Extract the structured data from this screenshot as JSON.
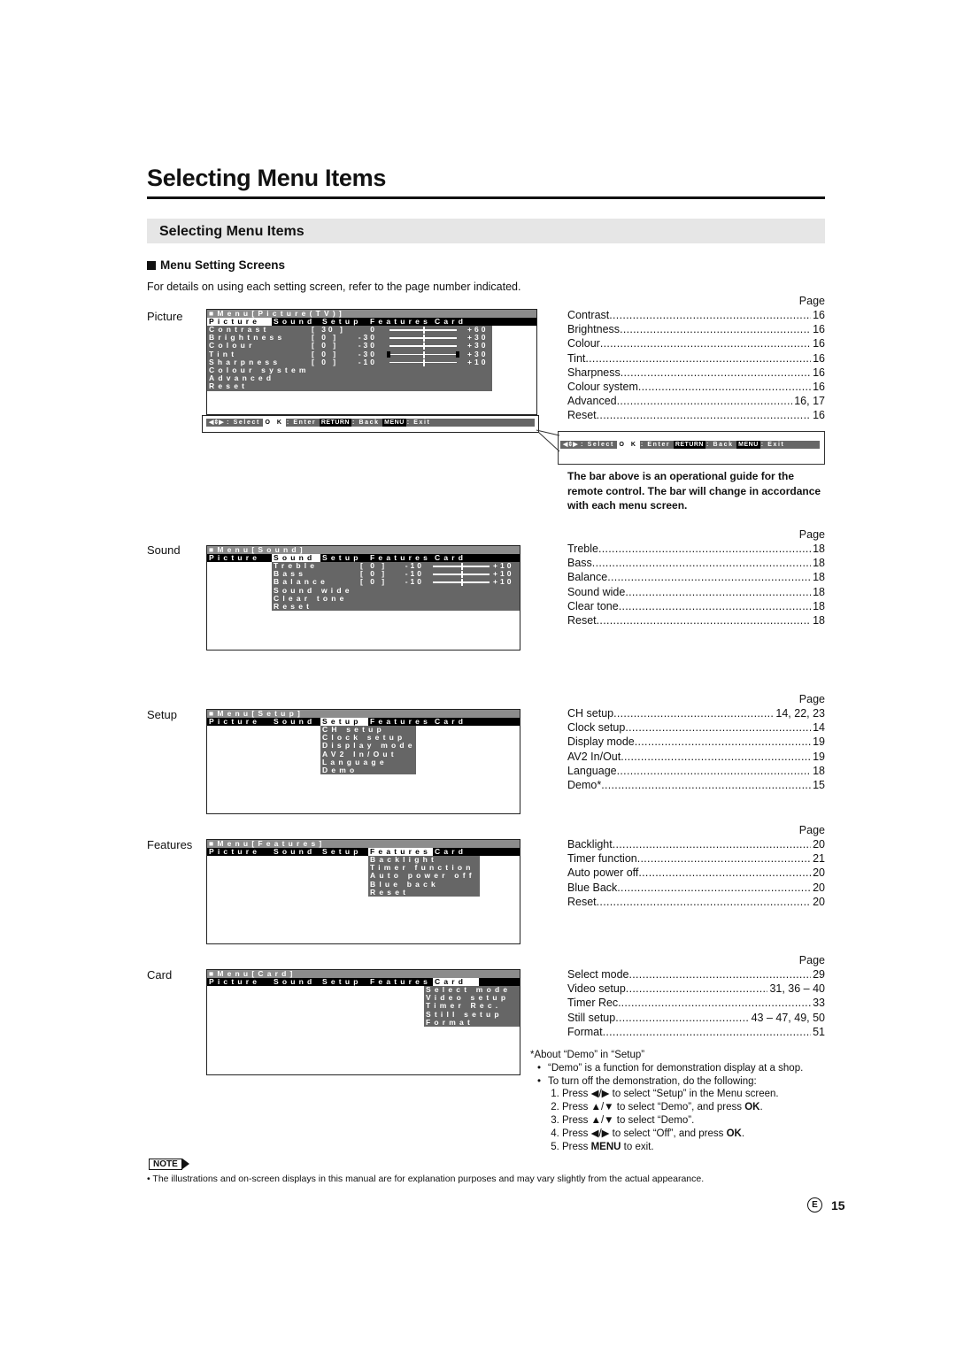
{
  "page": {
    "title": "Selecting Menu Items",
    "section_title": "Selecting Menu Items",
    "subsection_title": "Menu Setting Screens",
    "intro": "For details on using each setting screen, refer to the page number indicated.",
    "page_header": "Page"
  },
  "screens": {
    "picture": {
      "label": "Picture",
      "osd_title": "■Menu[Picture(TV)]",
      "tabs": [
        "Picture",
        "Sound",
        "Setup",
        "Features",
        "Card"
      ],
      "active_tab": "Picture",
      "rows": [
        {
          "name": "Contrast",
          "value": "30",
          "min": "0",
          "max": "+60"
        },
        {
          "name": "Brightness",
          "value": "0",
          "min": "-30",
          "max": "+30"
        },
        {
          "name": "Colour",
          "value": "0",
          "min": "-30",
          "max": "+30"
        },
        {
          "name": "Tint",
          "value": "0",
          "min": "-30",
          "max": "+30"
        },
        {
          "name": "Sharpness",
          "value": "0",
          "min": "-10",
          "max": "+10"
        },
        {
          "name": "Colour system"
        },
        {
          "name": "Advanced"
        },
        {
          "name": "Reset"
        }
      ],
      "guide": {
        "select": ": Select",
        "ok": "O K",
        "enter": ": Enter",
        "return": "RETURN",
        "back": ": Back",
        "menu": "MENU",
        "exit": ": Exit"
      },
      "pages": [
        {
          "item": "Contrast",
          "page": "16"
        },
        {
          "item": "Brightness",
          "page": "16"
        },
        {
          "item": "Colour",
          "page": "16"
        },
        {
          "item": "Tint",
          "page": "16"
        },
        {
          "item": "Sharpness",
          "page": "16"
        },
        {
          "item": "Colour system",
          "page": "16"
        },
        {
          "item": "Advanced",
          "page": "16, 17"
        },
        {
          "item": "Reset",
          "page": "16"
        }
      ]
    },
    "guide_note": "The bar above is an operational guide for the remote control. The bar will change in accordance with each menu screen.",
    "sound": {
      "label": "Sound",
      "osd_title": "■Menu[Sound]",
      "active_tab": "Sound",
      "rows": [
        {
          "name": "Treble",
          "value": "0",
          "min": "-10",
          "max": "+10"
        },
        {
          "name": "Bass",
          "value": "0",
          "min": "-10",
          "max": "+10"
        },
        {
          "name": "Balance",
          "value": "0",
          "min": "-10",
          "max": "+10"
        },
        {
          "name": "Sound wide"
        },
        {
          "name": "Clear tone"
        },
        {
          "name": "Reset"
        }
      ],
      "pages": [
        {
          "item": "Treble",
          "page": "18"
        },
        {
          "item": "Bass",
          "page": "18"
        },
        {
          "item": "Balance",
          "page": "18"
        },
        {
          "item": "Sound wide",
          "page": "18"
        },
        {
          "item": "Clear tone",
          "page": "18"
        },
        {
          "item": "Reset",
          "page": "18"
        }
      ]
    },
    "setup": {
      "label": "Setup",
      "osd_title": "■Menu[Setup]",
      "active_tab": "Setup",
      "rows": [
        {
          "name": "CH setup"
        },
        {
          "name": "Clock setup"
        },
        {
          "name": "Display mode"
        },
        {
          "name": "AV2 In/Out"
        },
        {
          "name": "Language"
        },
        {
          "name": "Demo"
        }
      ],
      "pages": [
        {
          "item": "CH setup",
          "page": "14, 22, 23"
        },
        {
          "item": "Clock setup",
          "page": "14"
        },
        {
          "item": "Display mode",
          "page": "19"
        },
        {
          "item": "AV2 In/Out",
          "page": "19"
        },
        {
          "item": "Language",
          "page": "18"
        },
        {
          "item": "Demo*",
          "page": "15"
        }
      ]
    },
    "features": {
      "label": "Features",
      "osd_title": "■Menu[Features]",
      "active_tab": "Features",
      "rows": [
        {
          "name": "Backlight"
        },
        {
          "name": "Timer function"
        },
        {
          "name": "Auto power off"
        },
        {
          "name": "Blue back"
        },
        {
          "name": "Reset"
        }
      ],
      "pages": [
        {
          "item": "Backlight",
          "page": "20"
        },
        {
          "item": "Timer function",
          "page": "21"
        },
        {
          "item": "Auto power off",
          "page": "20"
        },
        {
          "item": "Blue Back",
          "page": "20"
        },
        {
          "item": "Reset",
          "page": "20"
        }
      ]
    },
    "card": {
      "label": "Card",
      "osd_title": "■Menu[Card]",
      "active_tab": "Card",
      "rows": [
        {
          "name": "Select mode"
        },
        {
          "name": "Video setup"
        },
        {
          "name": "Timer Rec."
        },
        {
          "name": "Still setup"
        },
        {
          "name": "Format"
        }
      ],
      "pages": [
        {
          "item": "Select mode",
          "page": "29"
        },
        {
          "item": "Video setup",
          "page": "31, 36 – 40"
        },
        {
          "item": "Timer Rec.",
          "page": "33"
        },
        {
          "item": "Still setup",
          "page": "43 – 47, 49, 50"
        },
        {
          "item": "Format",
          "page": "51"
        }
      ]
    }
  },
  "demo_note": {
    "heading": "*About “Demo” in “Setup”",
    "bullets": [
      "“Demo” is a function for demonstration display at a shop.",
      "To turn off the demonstration, do the following:"
    ],
    "steps": [
      {
        "pre": "Press ",
        "icon": "◀/▶",
        "post": " to select “Setup” in the Menu screen.",
        "bold": ""
      },
      {
        "pre": "Press ",
        "icon": "▲/▼",
        "post": " to select “Demo”, and press ",
        "bold": "OK",
        "end": "."
      },
      {
        "pre": "Press ",
        "icon": "▲/▼",
        "post": " to select “Demo”.",
        "bold": ""
      },
      {
        "pre": "Press ",
        "icon": "◀/▶",
        "post": " to select “Off”, and press ",
        "bold": "OK",
        "end": "."
      },
      {
        "pre": "Press ",
        "icon": "",
        "post": " to exit.",
        "bold_first": "MENU"
      }
    ]
  },
  "note": {
    "tag": "NOTE",
    "text": "The illustrations and on-screen displays in this manual are for explanation purposes and may vary slightly from the actual appearance."
  },
  "footer": {
    "lang": "E",
    "page_number": "15"
  }
}
